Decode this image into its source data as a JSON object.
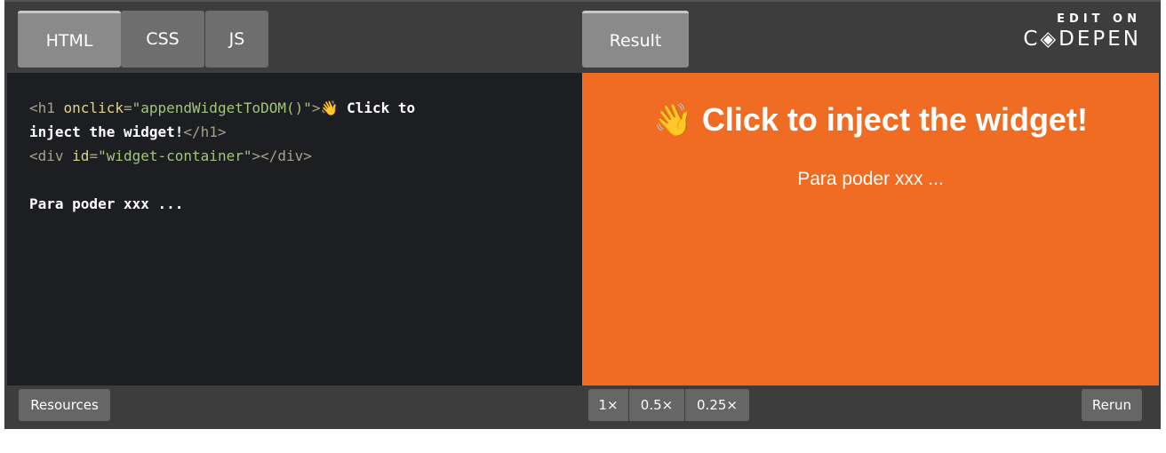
{
  "tabs": {
    "html": "HTML",
    "css": "CSS",
    "js": "JS",
    "result": "Result"
  },
  "brand": {
    "edit": "EDIT ON",
    "logo": "C◈DEPEN"
  },
  "code": {
    "l1_tag_open": "<h1 ",
    "l1_attr": "onclick",
    "l1_eq": "=",
    "l1_str": "\"appendWidgetToDOM()\"",
    "l1_close": ">",
    "l1_text": "👋 Click to",
    "l2_text": "inject the widget!",
    "l2_tag": "</h1>",
    "l3_tag_open": "<div ",
    "l3_attr": "id",
    "l3_eq": "=",
    "l3_str": "\"widget-container\"",
    "l3_tag_close": "></div>",
    "l5_text": "Para poder xxx ..."
  },
  "result": {
    "heading": "👋 Click to inject the widget!",
    "paragraph": "Para poder xxx ...",
    "bg_color": "#ef6c22"
  },
  "footer": {
    "resources": "Resources",
    "zoom": [
      "1×",
      "0.5×",
      "0.25×"
    ],
    "rerun": "Rerun"
  }
}
